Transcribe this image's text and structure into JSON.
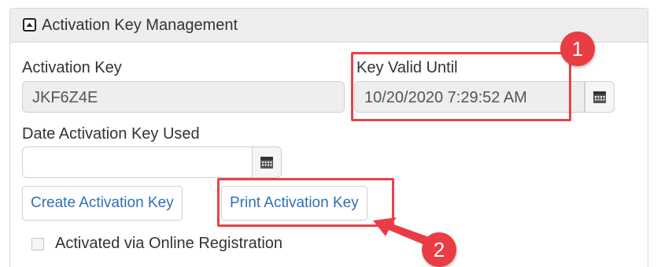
{
  "panel": {
    "title": "Activation Key Management",
    "collapse_icon": "collapse-square-icon"
  },
  "activation_key": {
    "label": "Activation Key",
    "value": "JKF6Z4E"
  },
  "key_valid_until": {
    "label": "Key Valid Until",
    "value": "10/20/2020 7:29:52 AM",
    "icon": "calendar-icon"
  },
  "date_used": {
    "label": "Date Activation Key Used",
    "value": "",
    "icon": "calendar-icon"
  },
  "buttons": {
    "create": "Create Activation Key",
    "print": "Print Activation Key"
  },
  "checkbox": {
    "label": "Activated via Online Registration",
    "checked": false
  },
  "annotations": {
    "step1": "1",
    "step2": "2",
    "highlight_color": "#e8424a"
  },
  "colors": {
    "link_blue": "#2f6fba",
    "header_bg": "#eeeeee",
    "readonly_bg": "#eeeeee"
  }
}
